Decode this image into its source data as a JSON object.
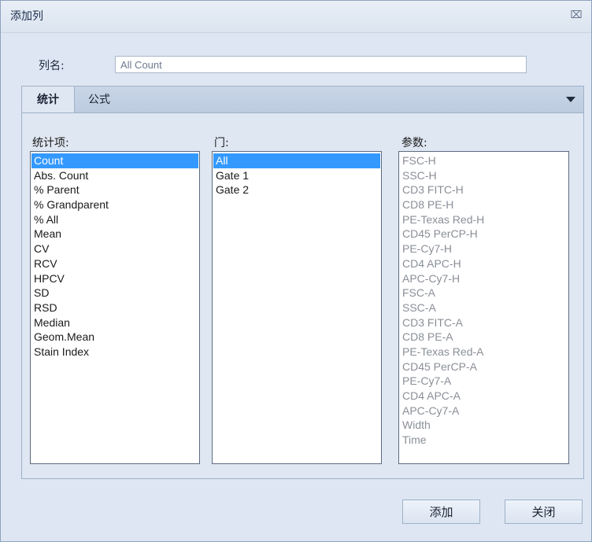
{
  "window": {
    "title": "添加列"
  },
  "name_field": {
    "label": "列名:",
    "value": "All Count"
  },
  "tabs": [
    {
      "label": "统计"
    },
    {
      "label": "公式"
    }
  ],
  "lists": {
    "stats": {
      "label": "统计项:",
      "items": [
        "Count",
        "Abs. Count",
        "% Parent",
        "% Grandparent",
        "% All",
        "Mean",
        "CV",
        "RCV",
        "HPCV",
        "SD",
        "RSD",
        "Median",
        "Geom.Mean",
        "Stain Index"
      ],
      "selected_index": 0
    },
    "gates": {
      "label": "门:",
      "items": [
        "All",
        "Gate 1",
        "Gate 2"
      ],
      "selected_index": 0
    },
    "params": {
      "label": "参数:",
      "items": [
        "FSC-H",
        "SSC-H",
        "CD3 FITC-H",
        "CD8 PE-H",
        "PE-Texas Red-H",
        "CD45 PerCP-H",
        "PE-Cy7-H",
        "CD4 APC-H",
        "APC-Cy7-H",
        "FSC-A",
        "SSC-A",
        "CD3 FITC-A",
        "CD8 PE-A",
        "PE-Texas Red-A",
        "CD45 PerCP-A",
        "PE-Cy7-A",
        "CD4 APC-A",
        "APC-Cy7-A",
        "Width",
        "Time"
      ],
      "disabled": true
    }
  },
  "buttons": {
    "add": "添加",
    "close": "关闭"
  }
}
